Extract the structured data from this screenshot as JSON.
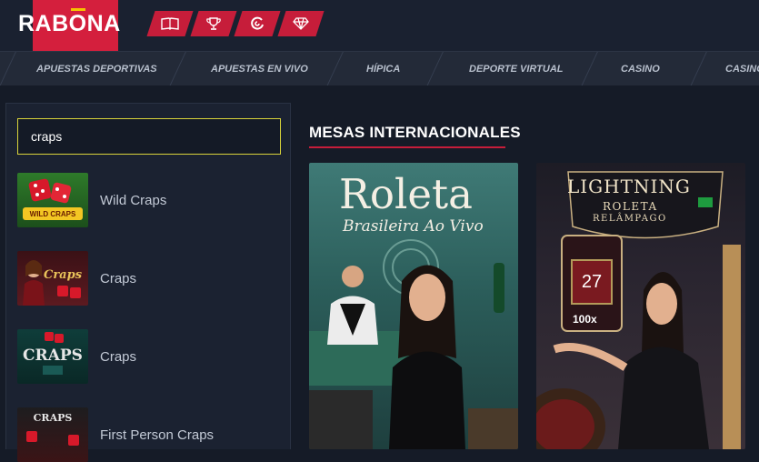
{
  "brand": {
    "name_pre": "RAB",
    "name_o": "O",
    "name_post": "NA"
  },
  "header_tabs": [
    {
      "icon": "book-icon"
    },
    {
      "icon": "trophy-icon"
    },
    {
      "icon": "spin-icon"
    },
    {
      "icon": "diamond-icon"
    }
  ],
  "nav": {
    "items": [
      "APUESTAS DEPORTIVAS",
      "APUESTAS EN VIVO",
      "HÍPICA",
      "DEPORTE VIRTUAL",
      "CASINO",
      "CASINO"
    ]
  },
  "search": {
    "value": "craps"
  },
  "results": [
    {
      "label": "Wild Craps",
      "thumb_text": "WILD CRAPS"
    },
    {
      "label": "Craps",
      "thumb_text": "Craps"
    },
    {
      "label": "Craps",
      "thumb_text": "CRAPS"
    },
    {
      "label": "First Person Craps",
      "thumb_text": "CRAPS"
    }
  ],
  "section": {
    "title": "MESAS INTERNACIONALES"
  },
  "cards": [
    {
      "title": "Roleta",
      "subtitle": "Brasileira Ao Vivo"
    },
    {
      "title": "LIGHTNING",
      "sub1": "ROLETA",
      "sub2": "RELÂMPAGO",
      "number": "27",
      "multiplier": "100x"
    }
  ],
  "colors": {
    "accent": "#c61d3a",
    "search_border": "#d8d33a",
    "logo_bg": "#d41f3d"
  }
}
